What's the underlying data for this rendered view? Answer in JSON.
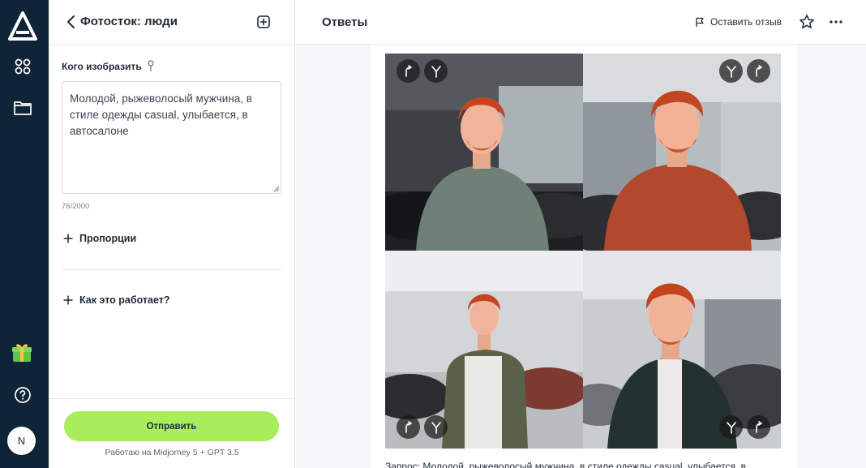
{
  "sidebar": {
    "icons": [
      "logo-icon",
      "apps-grid-icon",
      "folder-icon",
      "gift-icon",
      "help-icon"
    ],
    "avatar_initial": "N"
  },
  "panel": {
    "title": "Фотосток: люди",
    "field_label": "Кого изобразить",
    "prompt_value": "Молодой, рыжеволосый мужчина, в стиле одежды casual, улыбается, в автосалоне",
    "char_count": "76/2000",
    "proportions_label": "Пропорции",
    "how_it_works_label": "Как это работает?",
    "send_label": "Отправить",
    "engine_note": "Работаю на Midjorney 5 + GPT 3.5"
  },
  "main": {
    "title": "Ответы",
    "feedback_label": "Оставить отзыв",
    "query_text": "Запрос: Молодой, рыжеволосый мужчина, в стиле одежды casual, улыбается, в"
  },
  "colors": {
    "rail": "#0f2437",
    "accent_button": "#a8ee5b"
  }
}
